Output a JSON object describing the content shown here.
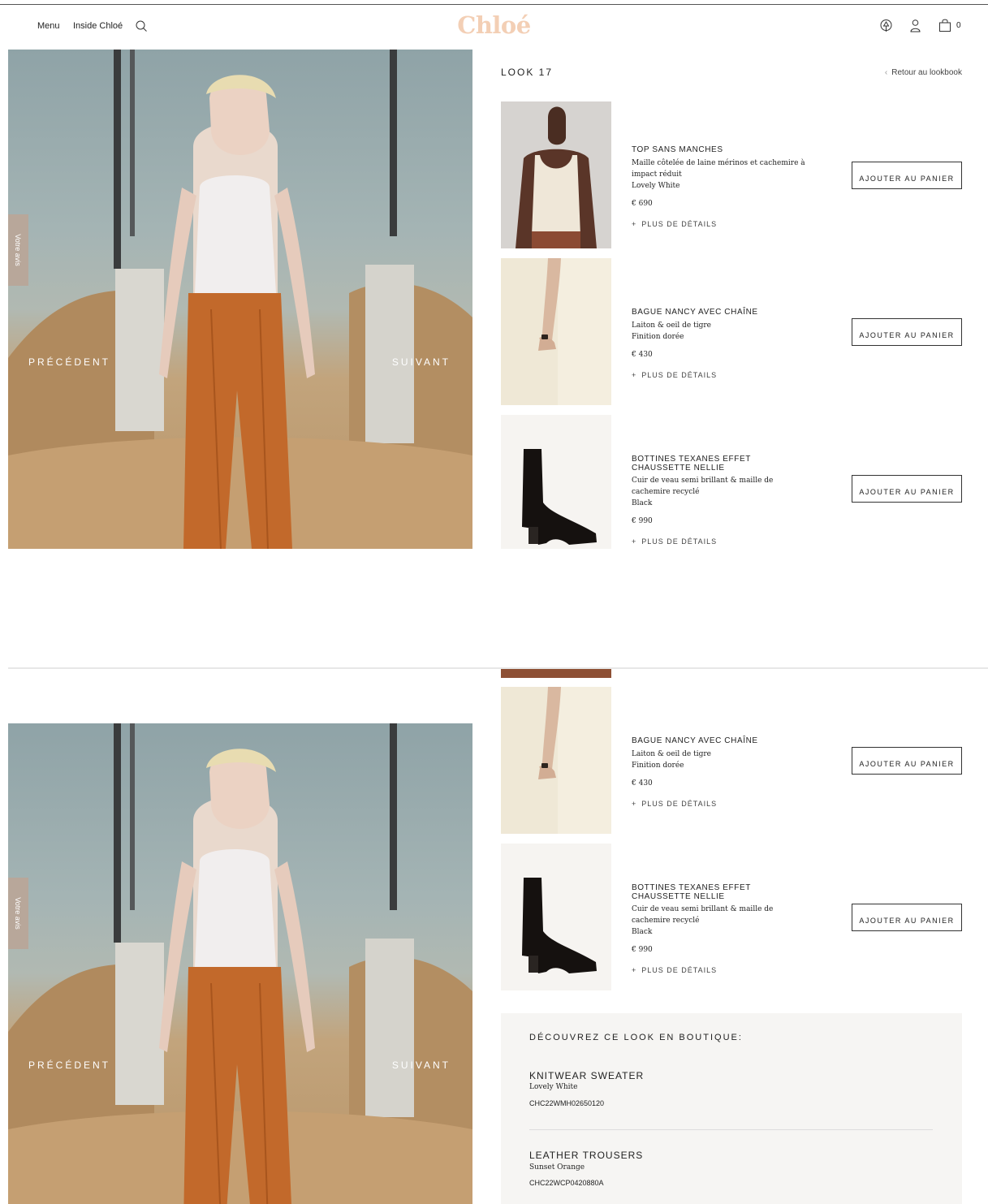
{
  "header": {
    "menu": "Menu",
    "inside": "Inside Chloé",
    "logo": "Chloé",
    "cart_count": "0",
    "icons": [
      "search-icon",
      "tree-icon",
      "user-icon",
      "bag-icon"
    ]
  },
  "hero": {
    "prev": "PRÉCÉDENT",
    "next": "SUIVANT",
    "feedback": "Votre avis"
  },
  "look": {
    "title": "LOOK 17",
    "back": "Retour au lookbook"
  },
  "products": [
    {
      "name_lines": [
        "TOP SANS MANCHES"
      ],
      "desc_lines": [
        "Maille côtelée de laine mérinos et cachemire à",
        "impact réduit",
        "Lovely White"
      ],
      "price": "€ 690",
      "more": "PLUS DE DÉTAILS",
      "button": "AJOUTER AU PANIER"
    },
    {
      "name_lines": [
        "BAGUE NANCY AVEC CHAÎNE"
      ],
      "desc_lines": [
        "Laiton & oeil de tigre",
        "Finition dorée"
      ],
      "price": "€ 430",
      "more": "PLUS DE DÉTAILS",
      "button": "AJOUTER AU PANIER"
    },
    {
      "name_lines": [
        "BOTTINES TEXANES EFFET",
        "CHAUSSETTE NELLIE"
      ],
      "desc_lines": [
        "Cuir de veau semi brillant & maille de",
        "cachemire recyclé",
        "Black"
      ],
      "price": "€ 990",
      "more": "PLUS DE DÉTAILS",
      "button": "AJOUTER AU PANIER"
    }
  ],
  "boutique": {
    "title": "DÉCOUVREZ CE LOOK EN BOUTIQUE:",
    "items": [
      {
        "name": "KNITWEAR SWEATER",
        "color": "Lovely White",
        "ref": "CHC22WMH02650120"
      },
      {
        "name": "LEATHER TROUSERS",
        "color": "Sunset Orange",
        "ref": "CHC22WCP0420880A"
      }
    ]
  },
  "colors": {
    "logo": "#f3cfb5",
    "trousers": "#c2692b",
    "top": "#f1eeee",
    "panel": "#f6f5f3"
  }
}
